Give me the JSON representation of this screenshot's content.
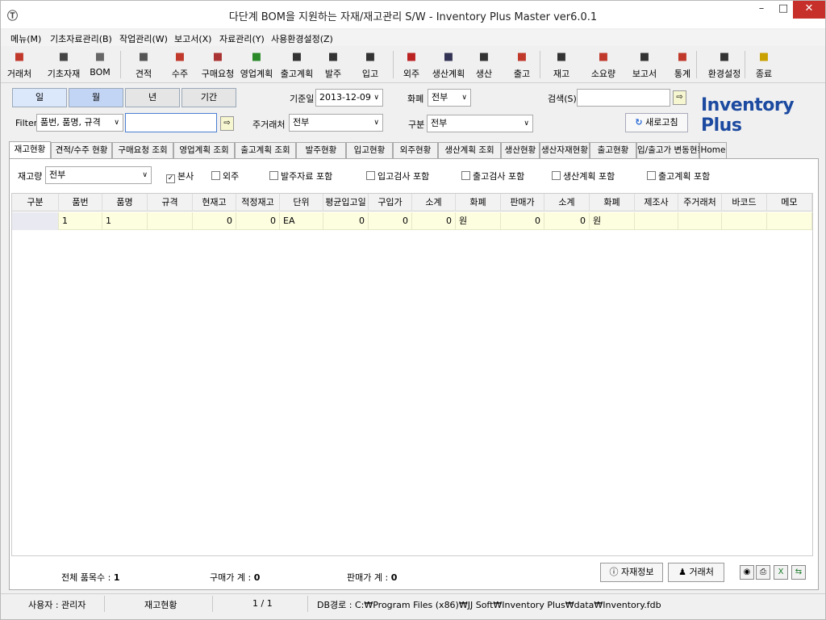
{
  "window": {
    "title": "다단계 BOM을 지원하는 자재/재고관리 S/W - Inventory Plus Master ver6.0.1",
    "minimize": "–",
    "maximize": "□",
    "close": "✕"
  },
  "menu": [
    "메뉴(M)",
    "기초자료관리(B)",
    "작업관리(W)",
    "보고서(X)",
    "자료관리(Y)",
    "사용환경설정(Z)"
  ],
  "toolbar": [
    {
      "label": "거래처",
      "icon": "address-book-icon",
      "color": "#c0392b"
    },
    {
      "label": "기초자재",
      "icon": "documents-icon",
      "color": "#444"
    },
    {
      "label": "BOM",
      "icon": "tree-icon",
      "color": "#666"
    },
    {
      "label": "견적",
      "icon": "document-icon",
      "color": "#555"
    },
    {
      "label": "수주",
      "icon": "order-icon",
      "color": "#c0392b"
    },
    {
      "label": "구매요청",
      "icon": "megaphone-icon",
      "color": "#a33"
    },
    {
      "label": "영업계획",
      "icon": "runner-icon",
      "color": "#2a8a2a"
    },
    {
      "label": "출고계획",
      "icon": "truck-plan-icon",
      "color": "#333"
    },
    {
      "label": "발주",
      "icon": "purchase-order-icon",
      "color": "#333"
    },
    {
      "label": "입고",
      "icon": "inbound-icon",
      "color": "#333"
    },
    {
      "label": "외주",
      "icon": "outsource-icon",
      "color": "#b22"
    },
    {
      "label": "생산계획",
      "icon": "calendar-icon",
      "color": "#335"
    },
    {
      "label": "생산",
      "icon": "production-icon",
      "color": "#333"
    },
    {
      "label": "출고",
      "icon": "outbound-icon",
      "color": "#c0392b"
    },
    {
      "label": "재고",
      "icon": "inventory-icon",
      "color": "#333"
    },
    {
      "label": "소요량",
      "icon": "requirement-icon",
      "color": "#c0392b"
    },
    {
      "label": "보고서",
      "icon": "report-icon",
      "color": "#333"
    },
    {
      "label": "통계",
      "icon": "statistics-icon",
      "color": "#c0392b"
    },
    {
      "label": "환경설정",
      "icon": "settings-icon",
      "color": "#333"
    },
    {
      "label": "종료",
      "icon": "exit-icon",
      "color": "#c9a100"
    }
  ],
  "period_buttons": [
    "일",
    "월",
    "년",
    "기간"
  ],
  "filter": {
    "label": "Filter",
    "value": "품번, 품명, 규격",
    "input": ""
  },
  "base_date": {
    "label": "기준일",
    "value": "2013-12-09"
  },
  "currency": {
    "label": "화폐",
    "value": "전부"
  },
  "search": {
    "label": "검색(S)",
    "value": ""
  },
  "main_customer": {
    "label": "주거래처",
    "value": "전부"
  },
  "category": {
    "label": "구분",
    "value": "전부"
  },
  "refresh_label": "새로고침",
  "brand": "Inventory Plus",
  "tabs": [
    "재고현황",
    "견적/수주 현황",
    "구매요청 조회",
    "영업계획 조회",
    "출고계획 조회",
    "발주현황",
    "입고현황",
    "외주현황",
    "생산계획 조회",
    "생산현황",
    "생산자재현황",
    "출고현황",
    "입/출고가 변동현황",
    "Home"
  ],
  "stock_filter": {
    "label": "재고량",
    "value": "전부"
  },
  "checkboxes": [
    {
      "label": "본사",
      "checked": true
    },
    {
      "label": "외주",
      "checked": false
    },
    {
      "label": "발주자료 포함",
      "checked": false
    },
    {
      "label": "입고검사 포함",
      "checked": false
    },
    {
      "label": "출고검사 포함",
      "checked": false
    },
    {
      "label": "생산계획 포함",
      "checked": false
    },
    {
      "label": "출고계획 포함",
      "checked": false
    }
  ],
  "grid": {
    "columns": [
      "구분",
      "품번",
      "품명",
      "규격",
      "현재고",
      "적정재고",
      "단위",
      "평균입고일",
      "구입가",
      "소계",
      "화폐",
      "판매가",
      "소계",
      "화폐",
      "제조사",
      "주거래처",
      "바코드",
      "메모"
    ],
    "rows": [
      [
        "",
        "1",
        "1",
        "",
        "0",
        "0",
        "EA",
        "0",
        "0",
        "0",
        "원",
        "0",
        "0",
        "원",
        "",
        "",
        "",
        ""
      ]
    ]
  },
  "summary": {
    "total_items_label": "전체 품목수 :",
    "total_items": "1",
    "purchase_total_label": "구매가 계 :",
    "purchase_total": "0",
    "sale_total_label": "판매가 계 :",
    "sale_total": "0"
  },
  "bottom_buttons": {
    "material_info": "자재정보",
    "customer": "거래처"
  },
  "status": {
    "user": "사용자 : 관리자",
    "screen": "재고현황",
    "page": "1 / 1",
    "db_path": "DB경로 : C:₩Program Files (x86)₩JJ Soft₩Inventory Plus₩data₩Inventory.fdb"
  }
}
